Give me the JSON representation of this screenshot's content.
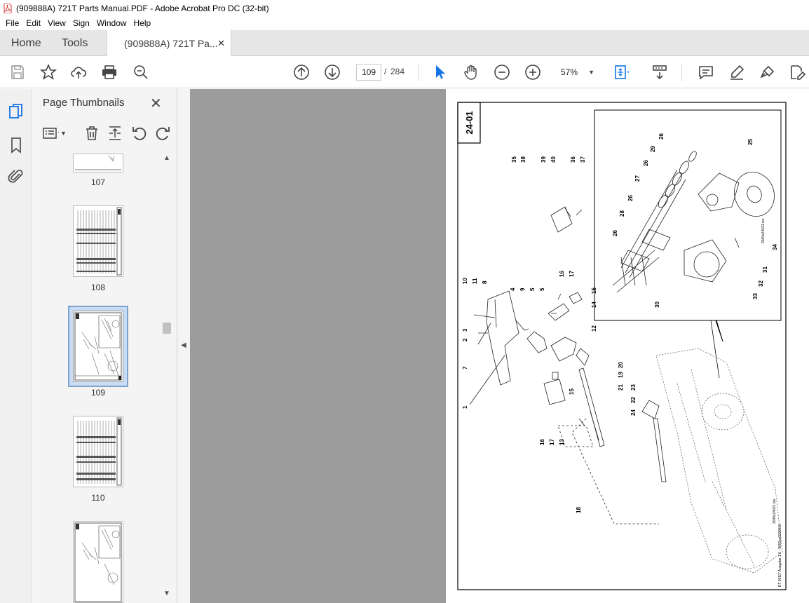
{
  "window": {
    "title": "(909888A) 721T Parts Manual.PDF - Adobe Acrobat Pro DC (32-bit)"
  },
  "menu": [
    "File",
    "Edit",
    "View",
    "Sign",
    "Window",
    "Help"
  ],
  "tabs": {
    "home": "Home",
    "tools": "Tools",
    "document": "(909888A) 721T Pa...",
    "close": "✕"
  },
  "toolbar": {
    "current_page": "109",
    "separator": "/",
    "total_pages": "284",
    "zoom": "57%"
  },
  "panel": {
    "title": "Page Thumbnails",
    "close": "✕",
    "thumbnails": [
      {
        "label": "107"
      },
      {
        "label": "108"
      },
      {
        "label": "109",
        "selected": true
      },
      {
        "label": "110"
      },
      {
        "label": ""
      }
    ]
  },
  "page": {
    "section_tag": "24-01",
    "callout_numbers": [
      "1",
      "2",
      "3",
      "4",
      "5",
      "5",
      "7",
      "8",
      "9",
      "10",
      "11",
      "12",
      "13",
      "14",
      "15",
      "15",
      "16",
      "16",
      "17",
      "17",
      "18",
      "19",
      "20",
      "21",
      "22",
      "23",
      "24",
      "25",
      "26",
      "26",
      "26",
      "26",
      "27",
      "28",
      "29",
      "30",
      "31",
      "32",
      "33",
      "34",
      "35",
      "36",
      "37",
      "38",
      "39",
      "40"
    ],
    "side_text_1": "3030x24021.iso",
    "side_text_2": "ET 3010\" Ausgabe 1.0 - 9000xx0000010",
    "side_text_3": "3030x24031.iso"
  },
  "colors": {
    "accent": "#1473e6",
    "tabbar": "#e6e6e6",
    "docbg": "#9c9c9c",
    "selection": "#c9dcf3"
  }
}
